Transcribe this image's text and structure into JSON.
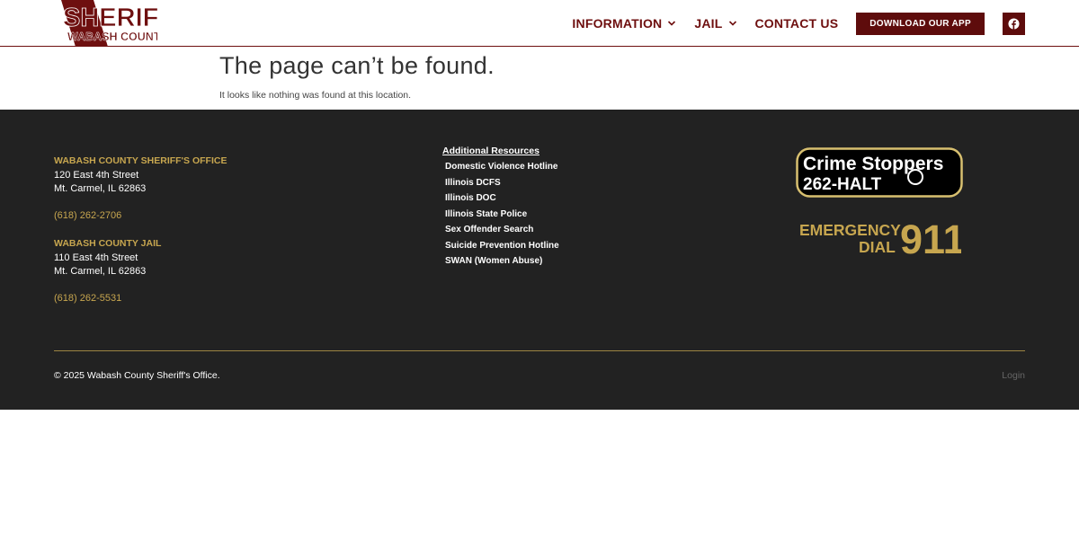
{
  "header": {
    "logo": {
      "top_text": "SHERIFF",
      "bottom_text": "WABASH COUNTY"
    },
    "nav": [
      {
        "label": "INFORMATION",
        "has_dropdown": true
      },
      {
        "label": "JAIL",
        "has_dropdown": true
      },
      {
        "label": "CONTACT US",
        "has_dropdown": false
      }
    ],
    "download_label": "DOWNLOAD OUR APP",
    "social_icon": "facebook-icon"
  },
  "main": {
    "title": "The page can’t be found.",
    "message": "It looks like nothing was found at this location."
  },
  "footer": {
    "office": {
      "title": "WABASH COUNTY SHERIFF'S OFFICE",
      "address1": "120 East 4th Street",
      "address2": "Mt. Carmel, IL 62863",
      "phone": "(618) 262-2706"
    },
    "jail": {
      "title": "WABASH COUNTY JAIL",
      "address1": "110 East 4th Street",
      "address2": "Mt. Carmel, IL 62863",
      "phone": "(618) 262-5531"
    },
    "resources": {
      "title": "Additional Resources",
      "items": [
        "Domestic Violence Hotline",
        "Illinois DCFS",
        "Illinois DOC",
        "Illinois State Police",
        "Sex Offender Search",
        "Suicide Prevention Hotline",
        "SWAN (Women Abuse)"
      ]
    },
    "crime_stoppers": {
      "line1": "Crime Stoppers",
      "line2": "262-HALT"
    },
    "emergency": {
      "line1": "EMERGENCY",
      "line2": "DIAL",
      "number": "911"
    },
    "copyright": "© 2025 Wabash County Sheriff's Office.",
    "login_label": "Login"
  },
  "colors": {
    "brand_maroon": "#6e0f0f",
    "button_maroon": "#5e0c0c",
    "footer_bg": "#222222",
    "gold": "#c7a64f"
  }
}
